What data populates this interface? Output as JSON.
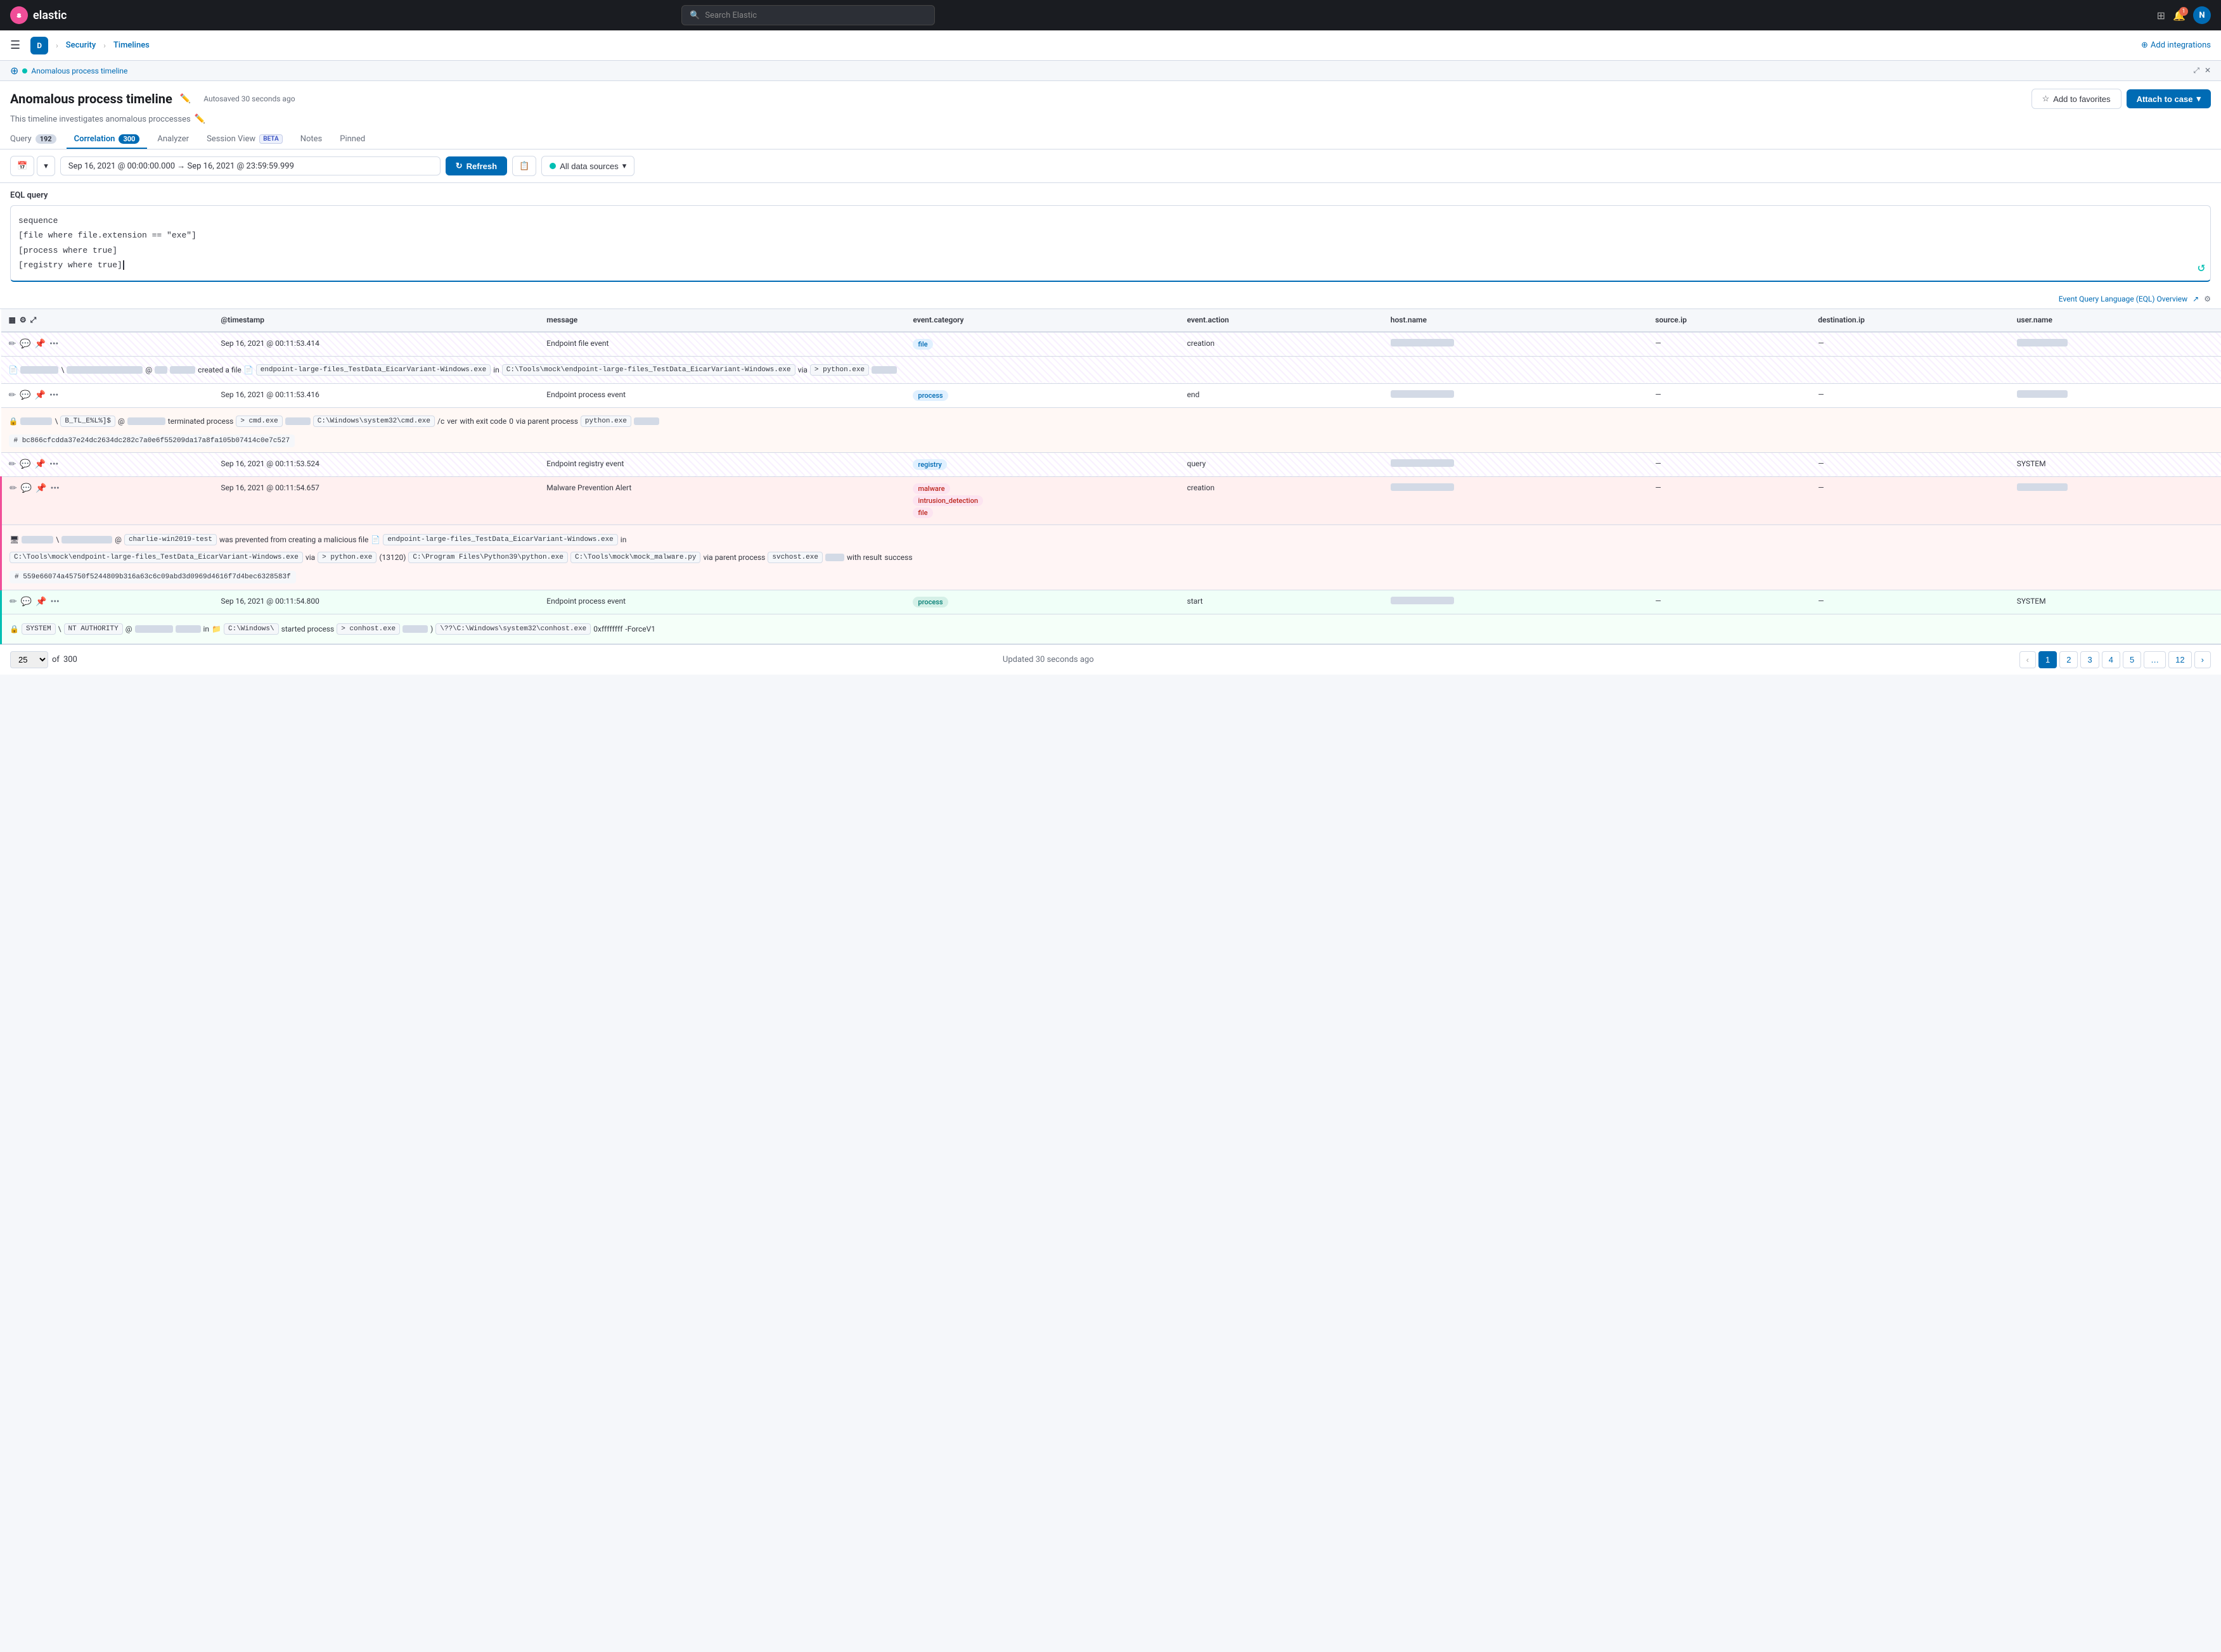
{
  "topnav": {
    "logo_text": "elastic",
    "logo_initial": "e",
    "search_placeholder": "Search Elastic",
    "avatar_initial": "N"
  },
  "secondarynav": {
    "breadcrumb_d": "D",
    "breadcrumb_security": "Security",
    "breadcrumb_timelines": "Timelines",
    "add_integrations": "Add integrations"
  },
  "breadcrumb": {
    "timeline_link": "Anomalous process timeline"
  },
  "header": {
    "title": "Anomalous process timeline",
    "autosaved": "Autosaved 30 seconds ago",
    "description": "This timeline investigates anomalous proccesses",
    "add_to_favorites": "Add to favorites",
    "attach_to_case": "Attach to case"
  },
  "tabs": [
    {
      "id": "query",
      "label": "Query",
      "badge": "192",
      "active": false
    },
    {
      "id": "correlation",
      "label": "Correlation",
      "badge": "300",
      "active": true
    },
    {
      "id": "analyzer",
      "label": "Analyzer",
      "badge": null,
      "active": false
    },
    {
      "id": "session_view",
      "label": "Session View",
      "badge": "BETA",
      "active": false
    },
    {
      "id": "notes",
      "label": "Notes",
      "badge": null,
      "active": false
    },
    {
      "id": "pinned",
      "label": "Pinned",
      "badge": null,
      "active": false
    }
  ],
  "toolbar": {
    "date_range": "Sep 16, 2021 @ 00:00:00.000  →  Sep 16, 2021 @ 23:59:59.999",
    "refresh_label": "Refresh",
    "datasources_label": "All data sources"
  },
  "eql": {
    "label": "EQL query",
    "line1": "sequence",
    "line2": "[file where file.extension == \"exe\"]",
    "line3": "[process where true]",
    "line4": "[registry where true]",
    "footer_link": "Event Query Language (EQL) Overview"
  },
  "table": {
    "columns": [
      "",
      "@timestamp",
      "message",
      "event.category",
      "event.action",
      "host.name",
      "source.ip",
      "destination.ip",
      "user.name"
    ],
    "rows": [
      {
        "id": "row1",
        "timestamp": "Sep 16, 2021 @ 00:11:53.414",
        "message": "Endpoint file event",
        "category": "file",
        "action": "creation",
        "host": "masked1",
        "source_ip": "—",
        "dest_ip": "—",
        "user": "masked2",
        "expand": {
          "detail": "created a file  endpoint-large-files_TestData_EicarVariant-Windows.exe  in  C:\\Tools\\mock\\endpoint-large-files_TestData_EicarVariant-Windows.exe  via  python.exe  masked"
        },
        "style": "zebra"
      },
      {
        "id": "row2",
        "timestamp": "Sep 16, 2021 @ 00:11:53.416",
        "message": "Endpoint process event",
        "category": "process",
        "action": "end",
        "host": "masked3",
        "source_ip": "—",
        "dest_ip": "—",
        "user": "masked4",
        "expand": {
          "detail": "terminated process  cmd.exe  masked  C:\\Windows\\system32\\cmd.exe  /c  ver  with exit code  0  via parent process  python.exe  masked",
          "hash": "# bc866cfcdda37e24dc2634dc282c7a0e6f55209da17a8fa105b07414c0e7c527"
        },
        "style": "normal"
      },
      {
        "id": "row3",
        "timestamp": "Sep 16, 2021 @ 00:11:53.524",
        "message": "Endpoint registry event",
        "category": "registry",
        "action": "query",
        "host": "masked5",
        "source_ip": "—",
        "dest_ip": "—",
        "user": "SYSTEM",
        "expand": null,
        "style": "zebra"
      },
      {
        "id": "row4",
        "timestamp": "Sep 16, 2021 @ 00:11:54.657",
        "message": "Malware Prevention Alert",
        "category": "malware intrusion_detection file",
        "action": "creation",
        "host": "masked6",
        "source_ip": "—",
        "dest_ip": "—",
        "user": "masked7",
        "expand": {
          "detail": "charlie-win2019-test  was prevented from creating a malicious file  endpoint-large-files_TestData_EicarVariant-Windows.exe  in  C:\\Tools\\mock\\endpoint-large-files_TestData_EicarVariant-Windows.exe  via  python.exe  (13120)  C:\\Program Files\\Python39\\python.exe  C:\\Tools\\mock\\mock_malware.py  via parent process  svchost.exe  masked  with result  success",
          "hash": "# 559e66074a45750f5244809b316a63c6c09abd3d0969d4616f7d4bec6328583f"
        },
        "style": "malware"
      },
      {
        "id": "row5",
        "timestamp": "Sep 16, 2021 @ 00:11:54.800",
        "message": "Endpoint process event",
        "category": "process",
        "action": "start",
        "host": "masked8",
        "source_ip": "—",
        "dest_ip": "—",
        "user": "SYSTEM",
        "expand": {
          "detail": "SYSTEM  \\  NT AUTHORITY  @  masked  in  C:\\Windows\\  started process  conhost.exe  masked  )  \\??\\C:\\Windows\\system32\\conhost.exe  0xffffffff  -ForceV1"
        },
        "style": "process"
      }
    ]
  },
  "footer": {
    "per_page": "25",
    "of_label": "of",
    "total": "300",
    "status": "Updated 30 seconds ago",
    "pages": [
      "1",
      "2",
      "3",
      "4",
      "5",
      "...",
      "12"
    ],
    "current_page": "1"
  }
}
